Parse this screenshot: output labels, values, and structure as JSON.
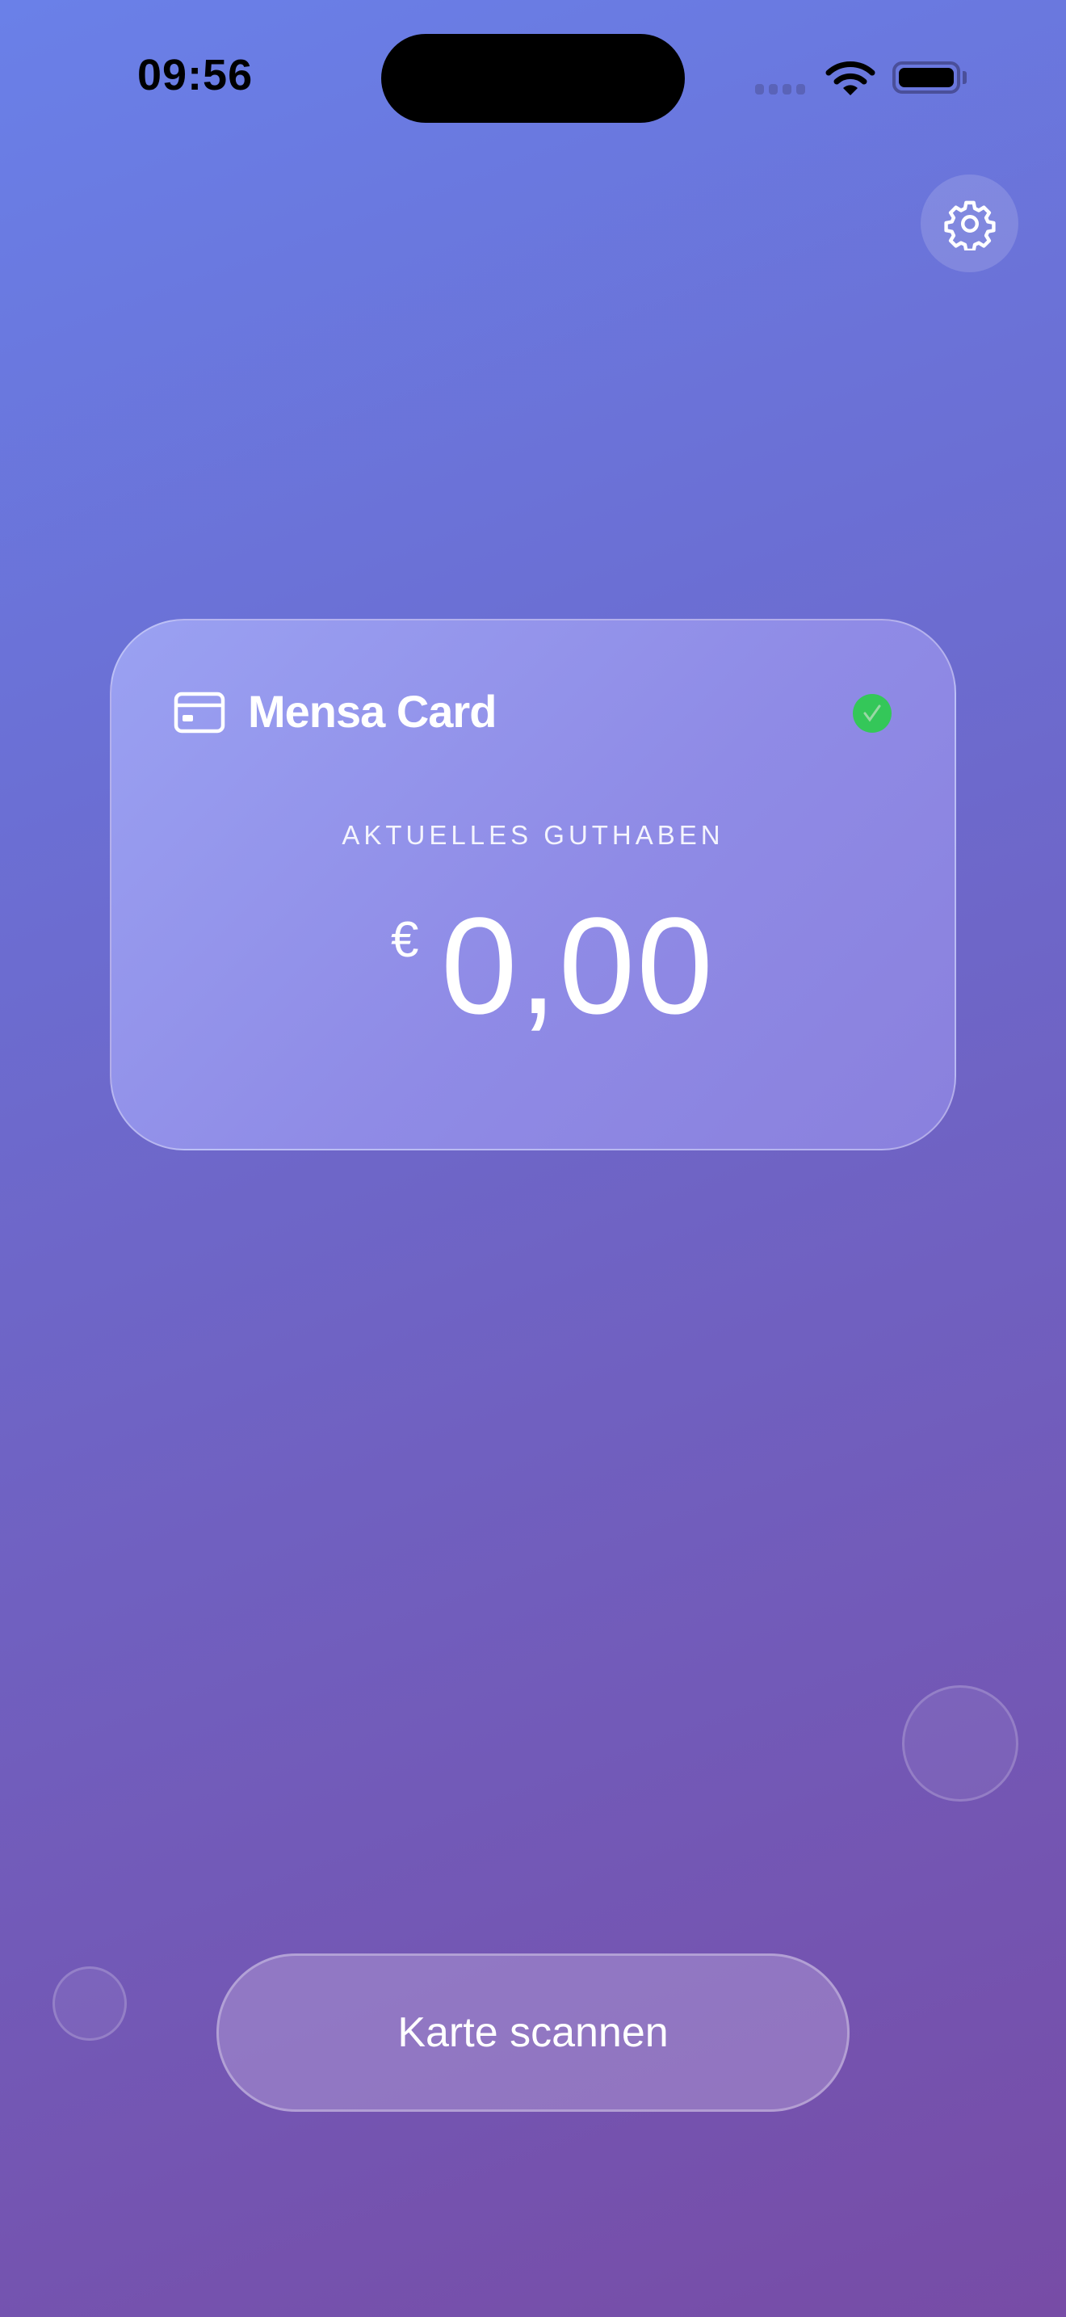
{
  "status_bar": {
    "time": "09:56",
    "icons": [
      "signal-icon",
      "wifi-icon",
      "battery-icon"
    ]
  },
  "header": {
    "settings_icon": "gear-icon"
  },
  "card": {
    "title": "Mensa Card",
    "icon": "credit-card-icon",
    "status_icon": "checkmark-circle-icon",
    "status_color": "#34c759",
    "balance_label": "AKTUELLES GUTHABEN",
    "currency": "€",
    "amount": "0,00"
  },
  "actions": {
    "scan_label": "Karte scannen"
  }
}
